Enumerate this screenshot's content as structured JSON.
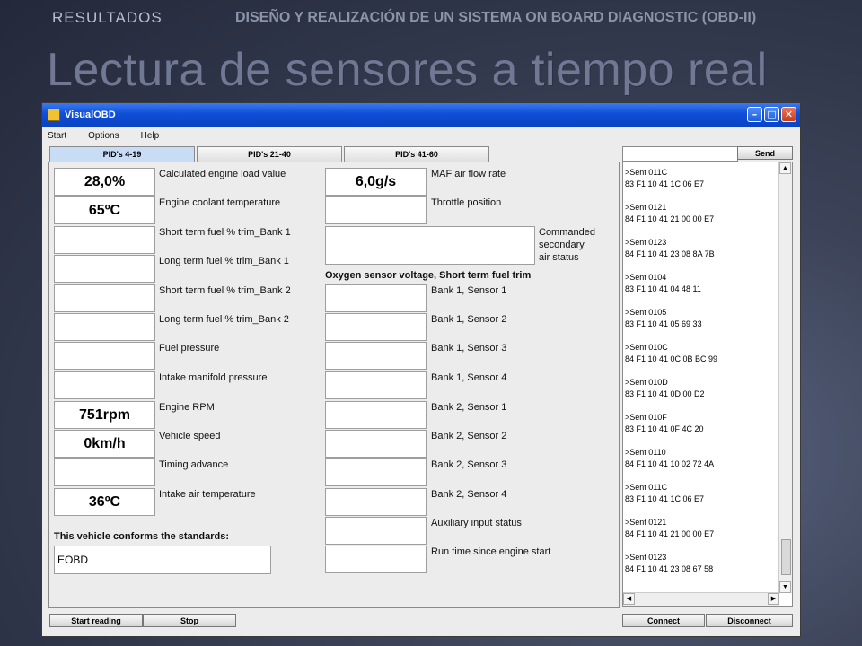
{
  "slide": {
    "section": "RESULTADOS",
    "subtitle": "DISEÑO Y REALIZACIÓN DE UN SISTEMA ON BOARD DIAGNOSTIC (OBD-II)",
    "title": "Lectura de sensores a tiempo real"
  },
  "window": {
    "title": "VisualOBD",
    "menu": [
      "Start",
      "Options",
      "Help"
    ]
  },
  "tabs": [
    "PID's 4-19",
    "PID's 21-40",
    "PID's 41-60"
  ],
  "left_rows": [
    {
      "value": "28,0%",
      "label": "Calculated engine load value"
    },
    {
      "value": "65ºC",
      "label": "Engine coolant temperature"
    },
    {
      "value": "",
      "label": "Short term fuel % trim_Bank 1"
    },
    {
      "value": "",
      "label": "Long term fuel % trim_Bank 1"
    },
    {
      "value": "",
      "label": "Short term fuel % trim_Bank 2"
    },
    {
      "value": "",
      "label": "Long term fuel % trim_Bank 2"
    },
    {
      "value": "",
      "label": "Fuel pressure"
    },
    {
      "value": "",
      "label": "Intake manifold pressure"
    },
    {
      "value": "751rpm",
      "label": "Engine RPM"
    },
    {
      "value": "0km/h",
      "label": "Vehicle speed"
    },
    {
      "value": "",
      "label": "Timing advance"
    },
    {
      "value": "36ºC",
      "label": "Intake air temperature"
    }
  ],
  "standards": {
    "label": "This vehicle conforms the standards:",
    "value": "EOBD"
  },
  "mid_top": [
    {
      "value": "6,0g/s",
      "label": "MAF air flow rate"
    },
    {
      "value": "",
      "label": "Throttle position"
    }
  ],
  "secondary_air": {
    "value": "",
    "label_lines": [
      "Commanded",
      "secondary",
      "air status"
    ]
  },
  "oxygen_header": "Oxygen sensor voltage, Short term fuel trim",
  "mid_rows": [
    {
      "value": "",
      "label": "Bank 1, Sensor 1"
    },
    {
      "value": "",
      "label": "Bank 1, Sensor 2"
    },
    {
      "value": "",
      "label": "Bank 1, Sensor 3"
    },
    {
      "value": "",
      "label": "Bank 1, Sensor 4"
    },
    {
      "value": "",
      "label": "Bank 2, Sensor 1"
    },
    {
      "value": "",
      "label": "Bank 2, Sensor 2"
    },
    {
      "value": "",
      "label": "Bank 2, Sensor 3"
    },
    {
      "value": "",
      "label": "Bank 2, Sensor 4"
    },
    {
      "value": "",
      "label": "Auxiliary input status"
    },
    {
      "value": "",
      "label": "Run time since engine start"
    }
  ],
  "send": {
    "input_value": "",
    "button": "Send"
  },
  "log": [
    {
      "sent": ">Sent 011C",
      "resp": "83 F1 10 41 1C 06 E7"
    },
    {
      "sent": ">Sent 0121",
      "resp": "84 F1 10 41 21 00 00 E7"
    },
    {
      "sent": ">Sent 0123",
      "resp": "84 F1 10 41 23 08 8A 7B"
    },
    {
      "sent": ">Sent 0104",
      "resp": "83 F1 10 41 04 48 11"
    },
    {
      "sent": ">Sent 0105",
      "resp": "83 F1 10 41 05 69 33"
    },
    {
      "sent": ">Sent 010C",
      "resp": "84 F1 10 41 0C 0B BC 99"
    },
    {
      "sent": ">Sent 010D",
      "resp": "83 F1 10 41 0D 00 D2"
    },
    {
      "sent": ">Sent 010F",
      "resp": "83 F1 10 41 0F 4C 20"
    },
    {
      "sent": ">Sent 0110",
      "resp": "84 F1 10 41 10 02 72 4A"
    },
    {
      "sent": ">Sent 011C",
      "resp": "83 F1 10 41 1C 06 E7"
    },
    {
      "sent": ">Sent 0121",
      "resp": "84 F1 10 41 21 00 00 E7"
    },
    {
      "sent": ">Sent 0123",
      "resp": "84 F1 10 41 23 08 67 58"
    }
  ],
  "buttons": {
    "start": "Start reading",
    "stop": "Stop",
    "connect": "Connect",
    "disconnect": "Disconnect"
  }
}
